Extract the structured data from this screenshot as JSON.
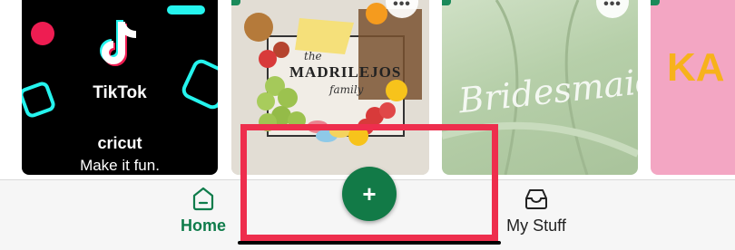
{
  "feed": {
    "cards": [
      {
        "brand_logo_text": "TikTok",
        "brand_name": "cricut",
        "tagline": "Make it fun."
      },
      {
        "sign_text_top": "the",
        "sign_text_main": "MADRILEJOS",
        "sign_text_bottom": "family"
      },
      {
        "robe_text": "Bridesmaid"
      },
      {
        "partial_text": "KA"
      }
    ]
  },
  "bottom_nav": {
    "home_label": "Home",
    "create_label": "+",
    "mystuff_label": "My Stuff"
  },
  "colors": {
    "accent_green": "#0f7c4b",
    "fab_green": "#127a47",
    "highlight_red": "#ee2e4d"
  }
}
